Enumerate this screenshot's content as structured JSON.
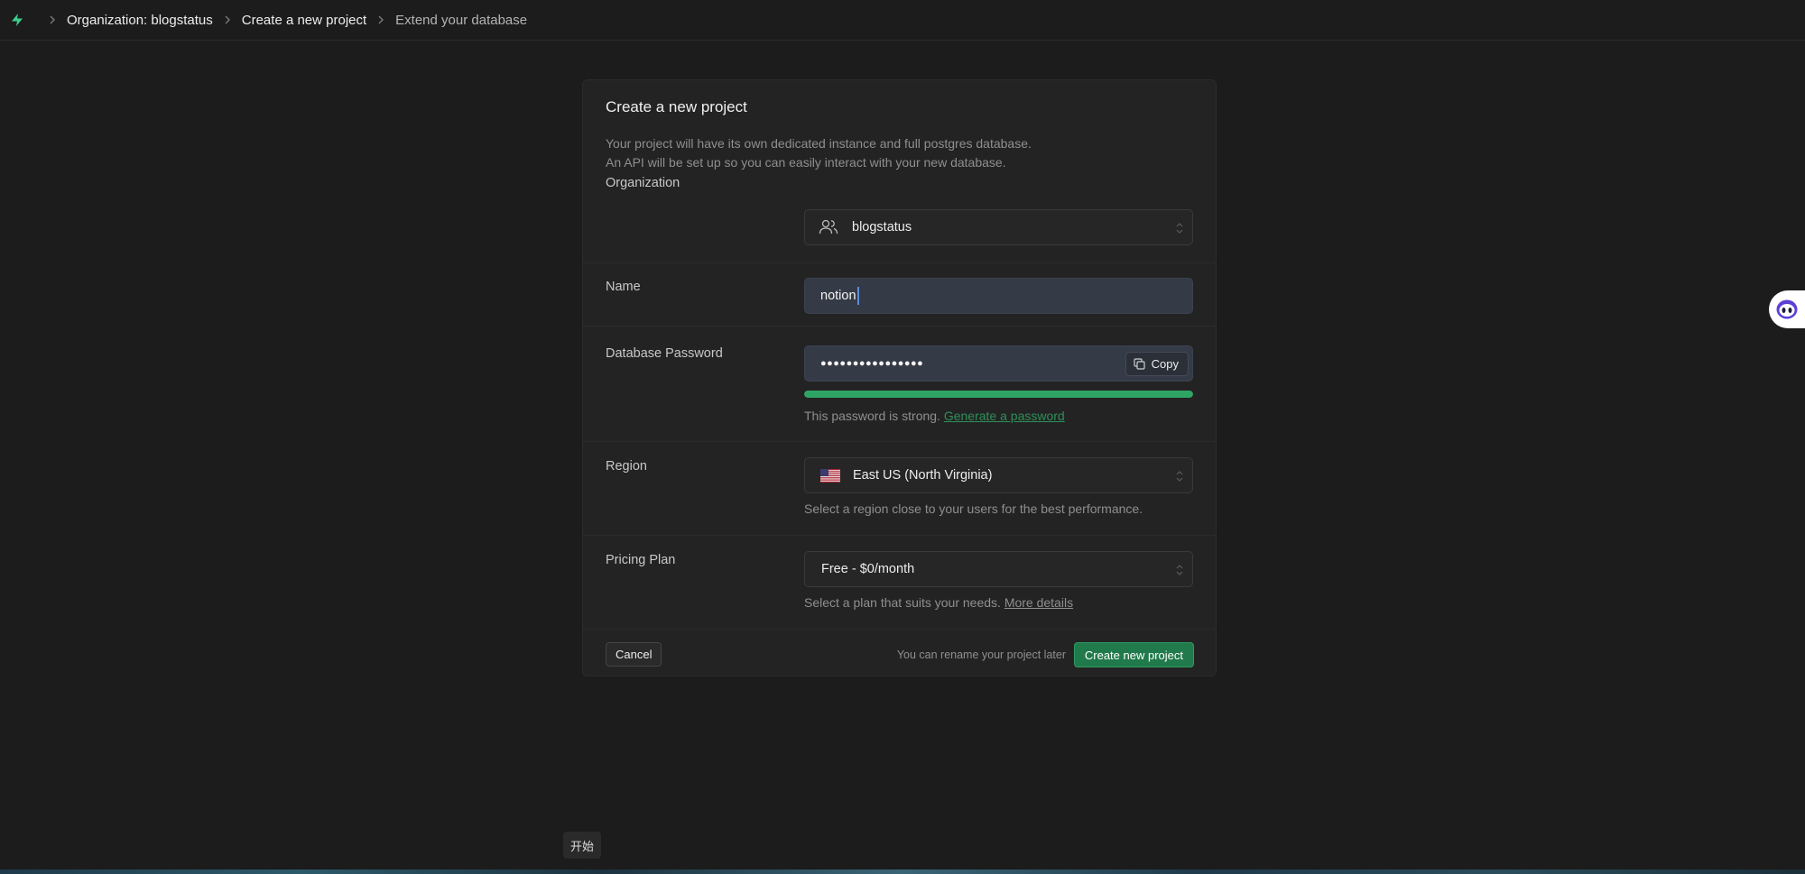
{
  "breadcrumb": {
    "items": [
      "Organization: blogstatus",
      "Create a new project",
      "Extend your database"
    ]
  },
  "card": {
    "title": "Create a new project",
    "desc_line1": "Your project will have its own dedicated instance and full postgres database.",
    "desc_line2": "An API will be set up so you can easily interact with your new database."
  },
  "organization": {
    "label": "Organization",
    "value": "blogstatus"
  },
  "name": {
    "label": "Name",
    "value": "notion"
  },
  "password": {
    "label": "Database Password",
    "masked_value": "●●●●●●●●●●●●●●●●",
    "copy_label": "Copy",
    "strength_fraction": 1.0,
    "strength_text": "This password is strong.",
    "generate_link": "Generate a password"
  },
  "region": {
    "label": "Region",
    "value": "East US (North Virginia)",
    "hint": "Select a region close to your users for the best performance."
  },
  "pricing": {
    "label": "Pricing Plan",
    "value": "Free - $0/month",
    "hint": "Select a plan that suits your needs.",
    "more_link": "More details"
  },
  "footer": {
    "cancel_label": "Cancel",
    "note": "You can rename your project later",
    "create_label": "Create new project"
  },
  "taskbar": {
    "start_label": "开始"
  },
  "colors": {
    "background": "#1c1c1c",
    "card": "#232323",
    "accent_green": "#217a4b",
    "strength_green": "#2fa565"
  }
}
